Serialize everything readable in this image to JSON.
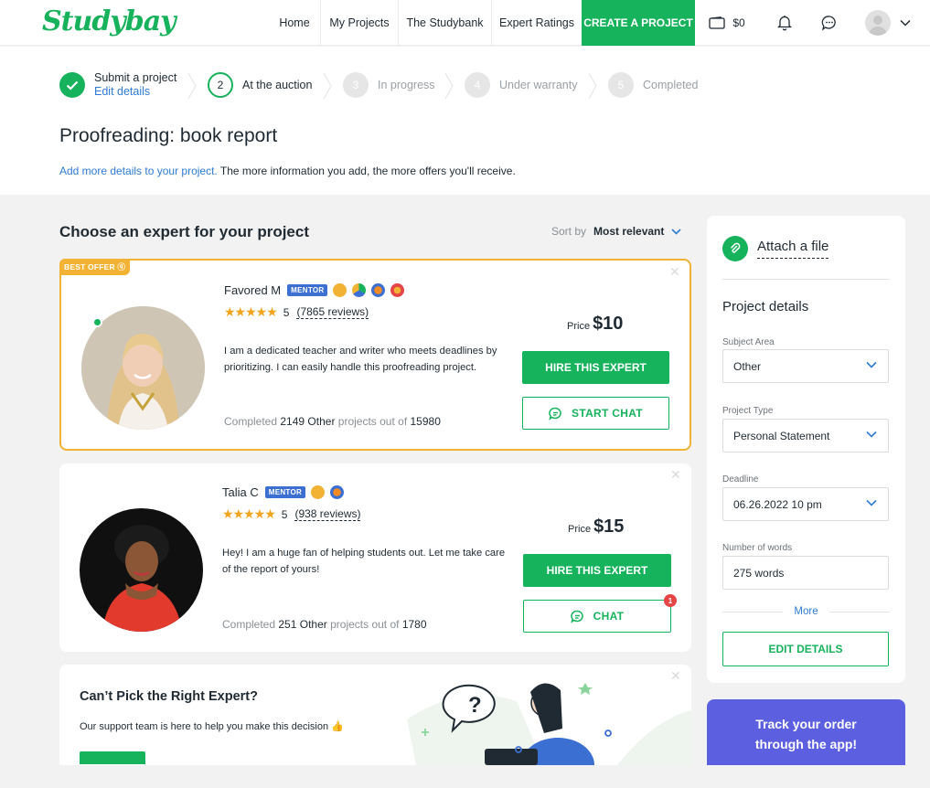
{
  "header": {
    "logo": "Studybay",
    "nav": [
      "Home",
      "My Projects",
      "The Studybank",
      "Expert Ratings"
    ],
    "create_label": "CREATE A PROJECT",
    "balance": "$0"
  },
  "steps": [
    {
      "label": "Submit a project",
      "sublabel": "Edit details",
      "state": "done"
    },
    {
      "number": "2",
      "label": "At the auction",
      "state": "active"
    },
    {
      "number": "3",
      "label": "In progress",
      "state": "todo"
    },
    {
      "number": "4",
      "label": "Under warranty",
      "state": "todo"
    },
    {
      "number": "5",
      "label": "Completed",
      "state": "todo"
    }
  ],
  "project": {
    "title": "Proofreading: book report",
    "hint_link": "Add more details to your project.",
    "hint_text": " The more information you add, the more offers you'll receive."
  },
  "experts_section": {
    "title": "Choose an expert for your project",
    "sort_label": "Sort by",
    "sort_value": "Most relevant"
  },
  "experts": [
    {
      "badge": "BEST OFFER",
      "name": "Favored M",
      "mentor": "MENTOR",
      "rating": "5",
      "reviews": "(7865 reviews)",
      "bio": "I am a dedicated teacher and writer who meets deadlines by prioritizing. I can easily handle this proofreading project.",
      "completed_label": "Completed",
      "completed_count": "2149",
      "completed_cat": "Other",
      "completed_mid": "projects out of",
      "completed_total": "15980",
      "price_label": "Price",
      "price": "$10",
      "hire_label": "HIRE THIS EXPERT",
      "chat_label": "START CHAT"
    },
    {
      "name": "Talia C",
      "mentor": "MENTOR",
      "rating": "5",
      "reviews": "(938 reviews)",
      "bio": "Hey! I am a huge fan of helping students out. Let me take care of the report of yours!",
      "completed_label": "Completed",
      "completed_count": "251",
      "completed_cat": "Other",
      "completed_mid": "projects out of",
      "completed_total": "1780",
      "price_label": "Price",
      "price": "$15",
      "hire_label": "HIRE THIS EXPERT",
      "chat_label": "CHAT",
      "chat_badge": "1"
    }
  ],
  "cant_pick": {
    "title": "Can’t Pick the Right Expert?",
    "subtitle": "Our support team is here to help you make this decision 👍"
  },
  "sidebar": {
    "attach_label": "Attach a file",
    "details_title": "Project details",
    "fields": [
      {
        "label": "Subject Area",
        "value": "Other",
        "type": "select"
      },
      {
        "label": "Project Type",
        "value": "Personal Statement",
        "type": "select"
      },
      {
        "label": "Deadline",
        "value": "06.26.2022 10 pm",
        "type": "select"
      },
      {
        "label": "Number of words",
        "value": "275 words",
        "type": "input"
      }
    ],
    "more_label": "More",
    "edit_label": "EDIT DETAILS"
  },
  "track_banner": "Track your order through the app!",
  "colors": {
    "brand_green": "#16b25c",
    "best_offer": "#f2b233",
    "mentor": "#3b6fd1",
    "link": "#2e7bd3",
    "track_banner": "#5b5fe0"
  }
}
